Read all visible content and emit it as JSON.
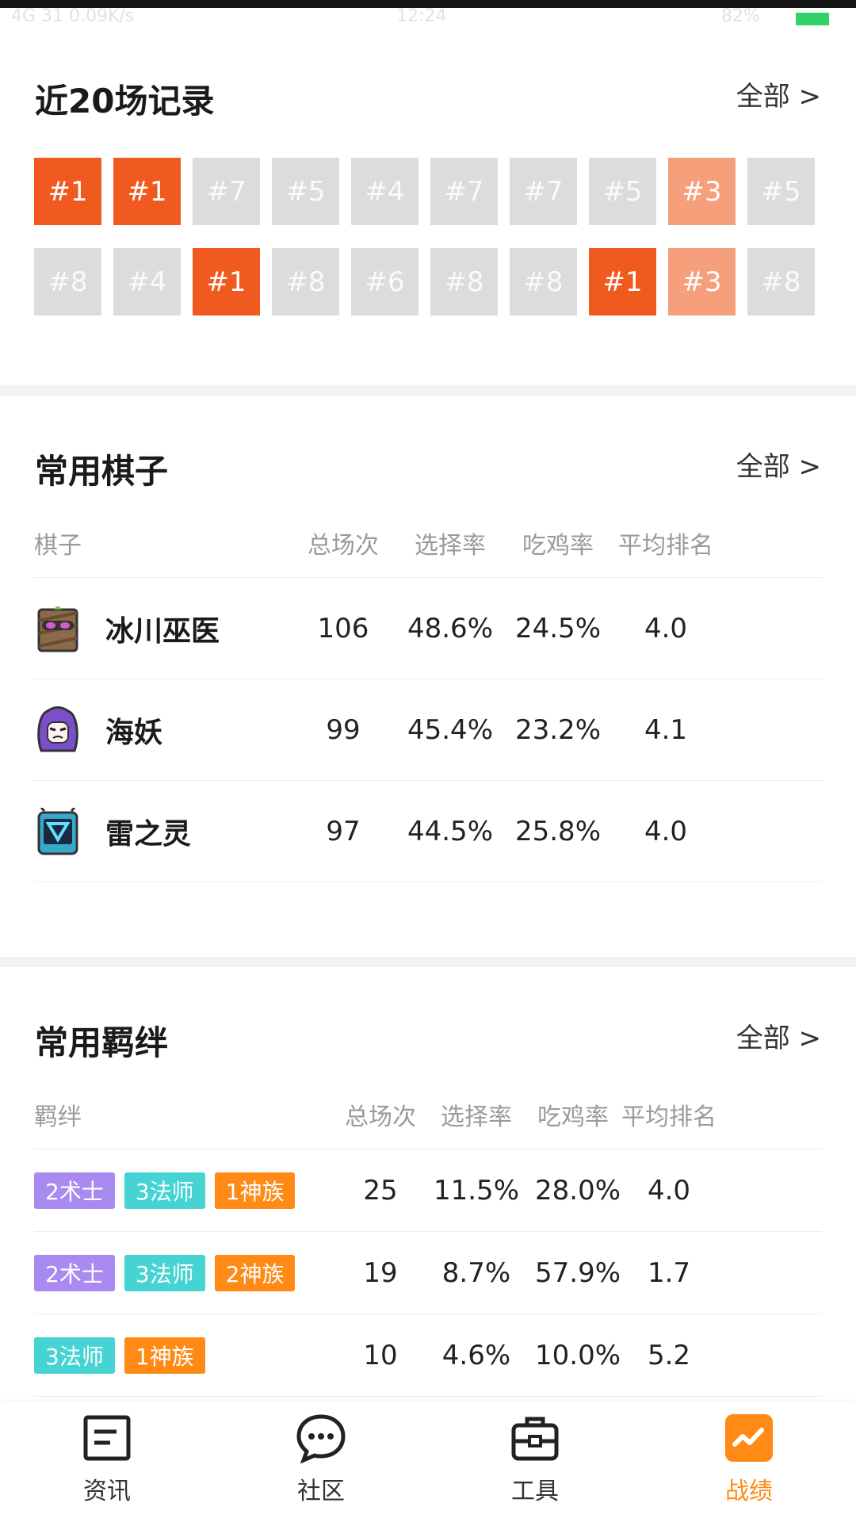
{
  "status": {
    "left": "4G 31 0.09K/s",
    "time": "12:24",
    "right": "82%"
  },
  "recent": {
    "title": "近20场记录",
    "more": "全部 >",
    "rows": [
      [
        {
          "label": "#1",
          "kind": "win"
        },
        {
          "label": "#1",
          "kind": "win"
        },
        {
          "label": "#7",
          "kind": "other"
        },
        {
          "label": "#5",
          "kind": "other"
        },
        {
          "label": "#4",
          "kind": "other"
        },
        {
          "label": "#7",
          "kind": "other"
        },
        {
          "label": "#7",
          "kind": "other"
        },
        {
          "label": "#5",
          "kind": "other"
        },
        {
          "label": "#3",
          "kind": "top"
        },
        {
          "label": "#5",
          "kind": "other"
        }
      ],
      [
        {
          "label": "#8",
          "kind": "other"
        },
        {
          "label": "#4",
          "kind": "other"
        },
        {
          "label": "#1",
          "kind": "win"
        },
        {
          "label": "#8",
          "kind": "other"
        },
        {
          "label": "#6",
          "kind": "other"
        },
        {
          "label": "#8",
          "kind": "other"
        },
        {
          "label": "#8",
          "kind": "other"
        },
        {
          "label": "#1",
          "kind": "win"
        },
        {
          "label": "#3",
          "kind": "top"
        },
        {
          "label": "#8",
          "kind": "other"
        }
      ]
    ]
  },
  "pieces": {
    "title": "常用棋子",
    "more": "全部 >",
    "headers": [
      "棋子",
      "总场次",
      "选择率",
      "吃鸡率",
      "平均排名"
    ],
    "rows": [
      {
        "name": "冰川巫医",
        "icon": "glacier-witch-doctor-avatar-icon",
        "games": "106",
        "pick": "48.6%",
        "win": "24.5%",
        "avg": "4.0"
      },
      {
        "name": "海妖",
        "icon": "siren-avatar-icon",
        "games": "99",
        "pick": "45.4%",
        "win": "23.2%",
        "avg": "4.1"
      },
      {
        "name": "雷之灵",
        "icon": "storm-spirit-avatar-icon",
        "games": "97",
        "pick": "44.5%",
        "win": "25.8%",
        "avg": "4.0"
      }
    ]
  },
  "synergies": {
    "title": "常用羁绊",
    "more": "全部 >",
    "headers": [
      "羁绊",
      "总场次",
      "选择率",
      "吃鸡率",
      "平均排名"
    ],
    "rows": [
      {
        "tags": [
          {
            "text": "2术士",
            "color": "#a98af0"
          },
          {
            "text": "3法师",
            "color": "#46d3d3"
          },
          {
            "text": "1神族",
            "color": "#ff8a16"
          }
        ],
        "games": "25",
        "pick": "11.5%",
        "win": "28.0%",
        "avg": "4.0"
      },
      {
        "tags": [
          {
            "text": "2术士",
            "color": "#a98af0"
          },
          {
            "text": "3法师",
            "color": "#46d3d3"
          },
          {
            "text": "2神族",
            "color": "#ff8a16"
          }
        ],
        "games": "19",
        "pick": "8.7%",
        "win": "57.9%",
        "avg": "1.7"
      },
      {
        "tags": [
          {
            "text": "3法师",
            "color": "#46d3d3"
          },
          {
            "text": "1神族",
            "color": "#ff8a16"
          }
        ],
        "games": "10",
        "pick": "4.6%",
        "win": "10.0%",
        "avg": "5.2"
      }
    ]
  },
  "tabbar": {
    "items": [
      {
        "label": "资讯",
        "icon": "news-icon",
        "active": false
      },
      {
        "label": "社区",
        "icon": "chat-bubble-icon",
        "active": false
      },
      {
        "label": "工具",
        "icon": "toolbox-icon",
        "active": false
      },
      {
        "label": "战绩",
        "icon": "trend-chart-icon",
        "active": true
      }
    ]
  },
  "colors": {
    "win": "#f05a1f",
    "top": "#f5a07a",
    "other": "#dcdcdc",
    "accent": "#ff8a16"
  }
}
